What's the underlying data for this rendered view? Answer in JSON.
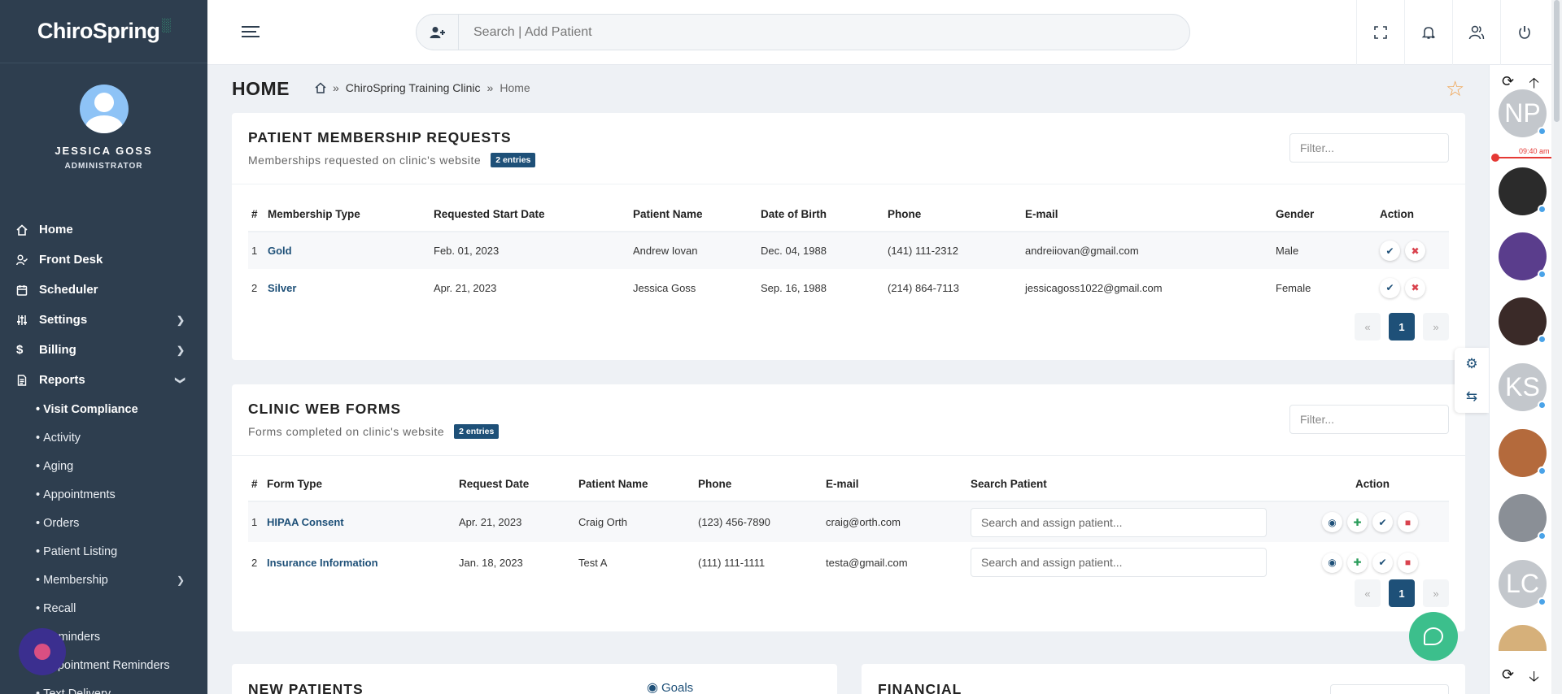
{
  "app": {
    "logo": "ChiroSpring"
  },
  "profile": {
    "name": "JESSICA GOSS",
    "role": "ADMINISTRATOR"
  },
  "nav": {
    "home": "Home",
    "front_desk": "Front Desk",
    "scheduler": "Scheduler",
    "settings": "Settings",
    "billing": "Billing",
    "reports": "Reports",
    "reports_sub": [
      "Visit Compliance",
      "Activity",
      "Aging",
      "Appointments",
      "Orders",
      "Patient Listing",
      "Membership",
      "Recall",
      "Reminders",
      "Appointment Reminders",
      "Text Delivery"
    ]
  },
  "search": {
    "placeholder": "Search | Add Patient"
  },
  "page": {
    "title": "HOME",
    "breadcrumb": {
      "clinic": "ChiroSpring Training Clinic",
      "current": "Home",
      "sep": "»"
    }
  },
  "membership": {
    "title": "PATIENT MEMBERSHIP REQUESTS",
    "subtitle": "Memberships requested on clinic's website",
    "badge": "2 entries",
    "filter_placeholder": "Filter...",
    "columns": [
      "#",
      "Membership Type",
      "Requested Start Date",
      "Patient Name",
      "Date of Birth",
      "Phone",
      "E-mail",
      "Gender",
      "Action"
    ],
    "rows": [
      {
        "num": "1",
        "type": "Gold",
        "start": "Feb. 01, 2023",
        "name": "Andrew Iovan",
        "dob": "Dec. 04, 1988",
        "phone": "(141) 111-2312",
        "email": "andreiiovan@gmail.com",
        "gender": "Male"
      },
      {
        "num": "2",
        "type": "Silver",
        "start": "Apr. 21, 2023",
        "name": "Jessica Goss",
        "dob": "Sep. 16, 1988",
        "phone": "(214) 864-7113",
        "email": "jessicagoss1022@gmail.com",
        "gender": "Female"
      }
    ],
    "pager": {
      "prev": "«",
      "page": "1",
      "next": "»"
    }
  },
  "webforms": {
    "title": "CLINIC WEB FORMS",
    "subtitle": "Forms completed on clinic's website",
    "badge": "2 entries",
    "filter_placeholder": "Filter...",
    "columns": [
      "#",
      "Form Type",
      "Request Date",
      "Patient Name",
      "Phone",
      "E-mail",
      "Search Patient",
      "Action"
    ],
    "assign_placeholder": "Search and assign patient...",
    "rows": [
      {
        "num": "1",
        "type": "HIPAA Consent",
        "date": "Apr. 21, 2023",
        "name": "Craig Orth",
        "phone": "(123) 456-7890",
        "email": "craig@orth.com"
      },
      {
        "num": "2",
        "type": "Insurance Information",
        "date": "Jan. 18, 2023",
        "name": "Test A",
        "phone": "(111) 111-1111",
        "email": "testa@gmail.com"
      }
    ],
    "pager": {
      "prev": "«",
      "page": "1",
      "next": "»"
    }
  },
  "new_patients": {
    "title": "NEW PATIENTS",
    "goals": "Goals"
  },
  "financial": {
    "title": "FINANCIAL"
  },
  "rail": {
    "time": "09:40 am",
    "avatars": [
      {
        "initials": "NP",
        "color": "#c3c7cc"
      },
      {
        "initials": "",
        "color": "#2b2b2b"
      },
      {
        "initials": "",
        "color": "#5a3d8c"
      },
      {
        "initials": "",
        "color": "#3a2a28"
      },
      {
        "initials": "KS",
        "color": "#c3c7cc"
      },
      {
        "initials": "",
        "color": "#b46a3c"
      },
      {
        "initials": "",
        "color": "#8a8f96"
      },
      {
        "initials": "LC",
        "color": "#c3c7cc"
      },
      {
        "initials": "",
        "color": "#d6b07a"
      }
    ]
  },
  "colors": {
    "sidebar": "#2e3e4f",
    "primary": "#1e5078",
    "accent": "#3cbf8c",
    "danger": "#d9434e",
    "star": "#f0a04b"
  }
}
